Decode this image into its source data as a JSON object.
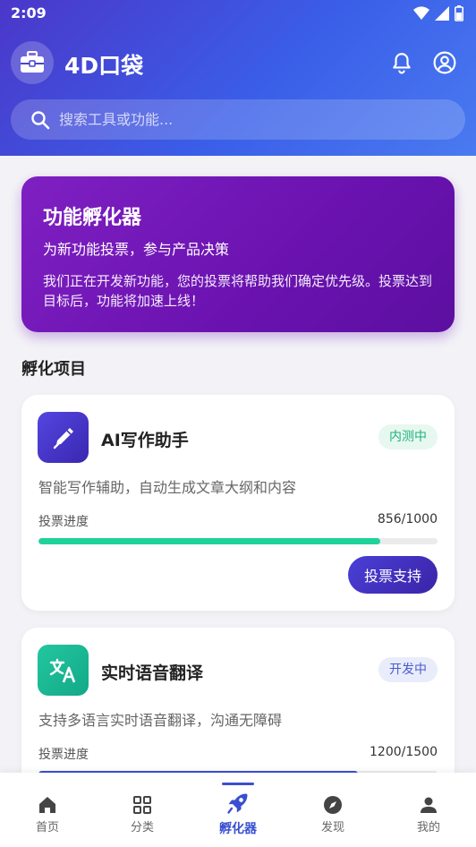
{
  "status": {
    "time": "2:09"
  },
  "header": {
    "app_title": "4D口袋"
  },
  "search": {
    "placeholder": "搜索工具或功能..."
  },
  "banner": {
    "title": "功能孵化器",
    "subtitle": "为新功能投票，参与产品决策",
    "description": "我们正在开发新功能，您的投票将帮助我们确定优先级。投票达到目标后，功能将加速上线！"
  },
  "section": {
    "title": "孵化项目"
  },
  "projects": [
    {
      "title": "AI写作助手",
      "badge": "内测中",
      "description": "智能写作辅助，自动生成文章大纲和内容",
      "progress_label": "投票进度",
      "progress_count": "856/1000",
      "progress_fraction": 0.856,
      "icon": "pen-icon",
      "button_label": "投票支持"
    },
    {
      "title": "实时语音翻译",
      "badge": "开发中",
      "description": "支持多语言实时语音翻译，沟通无障碍",
      "progress_label": "投票进度",
      "progress_count": "1200/1500",
      "progress_fraction": 0.8,
      "icon": "translate-icon"
    }
  ],
  "nav": {
    "items": [
      {
        "label": "首页",
        "icon": "home-icon"
      },
      {
        "label": "分类",
        "icon": "grid-icon"
      },
      {
        "label": "孵化器",
        "icon": "rocket-icon"
      },
      {
        "label": "发现",
        "icon": "compass-icon"
      },
      {
        "label": "我的",
        "icon": "person-icon"
      }
    ],
    "active_index": 2
  },
  "colors": {
    "header_gradient": [
      "#4b37c9",
      "#4a7af0"
    ],
    "banner": "#6a12b0",
    "progress_green": "#1fd29a",
    "progress_blue": "#3a4fd0",
    "nav_active": "#3a4fd0"
  }
}
